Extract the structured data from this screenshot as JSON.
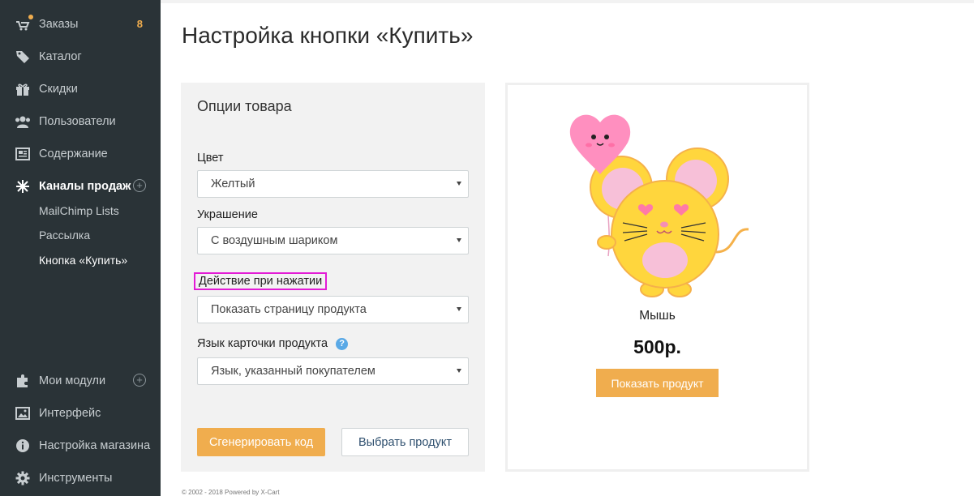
{
  "sidebar": {
    "items": [
      {
        "label": "Заказы",
        "icon": "orders-icon",
        "badge": "8"
      },
      {
        "label": "Каталог",
        "icon": "tag-icon"
      },
      {
        "label": "Скидки",
        "icon": "gift-icon"
      },
      {
        "label": "Пользователи",
        "icon": "users-icon"
      },
      {
        "label": "Содержание",
        "icon": "content-icon"
      },
      {
        "label": "Каналы продаж",
        "icon": "asterisk-icon"
      },
      {
        "label": "Мои модули",
        "icon": "puzzle-icon"
      },
      {
        "label": "Интерфейс",
        "icon": "image-icon"
      },
      {
        "label": "Настройка магазина",
        "icon": "info-icon"
      },
      {
        "label": "Инструменты",
        "icon": "gear-icon"
      }
    ],
    "subitems": [
      "MailChimp Lists",
      "Рассылка",
      "Кнопка «Купить»"
    ]
  },
  "page": {
    "title": "Настройка кнопки «Купить»"
  },
  "options": {
    "title": "Опции товара",
    "color_label": "Цвет",
    "color_value": "Желтый",
    "decoration_label": "Украшение",
    "decoration_value": "С воздушным шариком",
    "action_label": "Действие при нажатии",
    "action_value": "Показать страницу продукта",
    "language_label": "Язык карточки продукта",
    "language_value": "Язык, указанный покупателем",
    "generate_button": "Сгенерировать код",
    "select_product_button": "Выбрать продукт"
  },
  "preview": {
    "product_name": "Мышь",
    "price": "500р.",
    "show_button": "Показать продукт"
  },
  "footer": {
    "text": "© 2002 - 2018 Powered by X-Cart"
  },
  "colors": {
    "sidebar_bg": "#2a3337",
    "accent": "#f0ad4e",
    "highlight_border": "#e31bd6"
  }
}
